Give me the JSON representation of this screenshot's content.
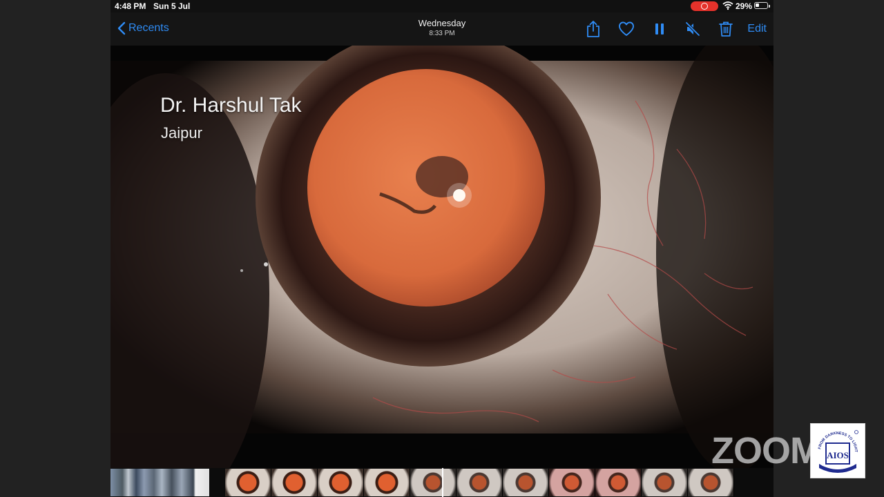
{
  "status_bar": {
    "time": "4:48 PM",
    "date": "Sun 5 Jul",
    "battery": "29%",
    "recording_color": "#e5322b"
  },
  "nav": {
    "back_label": "Recents",
    "title_day": "Wednesday",
    "title_time": "8:33 PM",
    "actions": [
      "share-icon",
      "heart-icon",
      "pause-icon",
      "mute-icon",
      "trash-icon"
    ],
    "edit_label": "Edit",
    "accent_color": "#2f8cf5"
  },
  "video": {
    "overlay_name": "Dr. Harshul Tak",
    "overlay_city": "Jaipur"
  },
  "watermark": {
    "text": "ZOOM"
  },
  "logo": {
    "top_text": "FROM DARKNESS TO LIGHT",
    "monogram": "AIOS",
    "color": "#1f2b8f"
  }
}
